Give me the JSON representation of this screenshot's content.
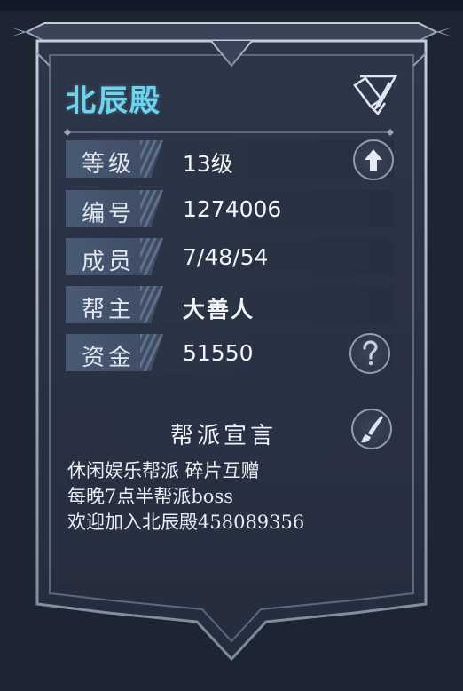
{
  "guild": {
    "name": "北辰殿"
  },
  "info_rows": [
    {
      "label": "等级",
      "value": "13级"
    },
    {
      "label": "编号",
      "value": "1274006"
    },
    {
      "label": "成员",
      "value": "7/48/54"
    },
    {
      "label": "帮主",
      "value": "大善人"
    },
    {
      "label": "资金",
      "value": "51550"
    }
  ],
  "declaration": {
    "title": "帮派宣言",
    "lines": [
      "休闲娱乐帮派 碎片互赠",
      "每晚7点半帮派boss",
      "欢迎加入北辰殿458089356"
    ]
  },
  "icons": {
    "edit_name": "brush-edit-icon",
    "upgrade": "arrow-up-icon",
    "help": "question-icon",
    "edit_declaration": "brush-icon"
  },
  "colors": {
    "title": "#6fd3ec",
    "background": "#1d2532",
    "panel": "#2b3446"
  }
}
